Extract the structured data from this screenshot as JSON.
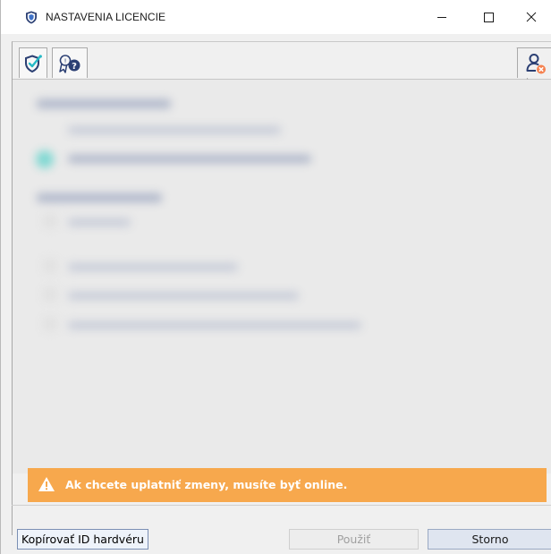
{
  "window": {
    "title": "NASTAVENIA LICENCIE",
    "controls": {
      "minimize": "minimize-icon",
      "maximize": "maximize-icon",
      "close": "close-icon"
    }
  },
  "tabs": [
    {
      "icon": "shield-check-icon",
      "active": true
    },
    {
      "icon": "license-info-icon",
      "active": false
    },
    {
      "icon": "user-remove-icon",
      "active": false
    }
  ],
  "content": {
    "blurred": true
  },
  "warning": {
    "icon": "warning-icon",
    "text": "Ak chcete uplatniť zmeny, musíte byť online.",
    "color": "#f7a84d"
  },
  "buttons": {
    "copy_hw_id": "Kopírovať ID hardvéru",
    "apply": "Použiť",
    "cancel": "Storno"
  },
  "colors": {
    "accent": "#1f5fbf",
    "warning": "#f7a84d",
    "teal": "#3ecbc0"
  }
}
